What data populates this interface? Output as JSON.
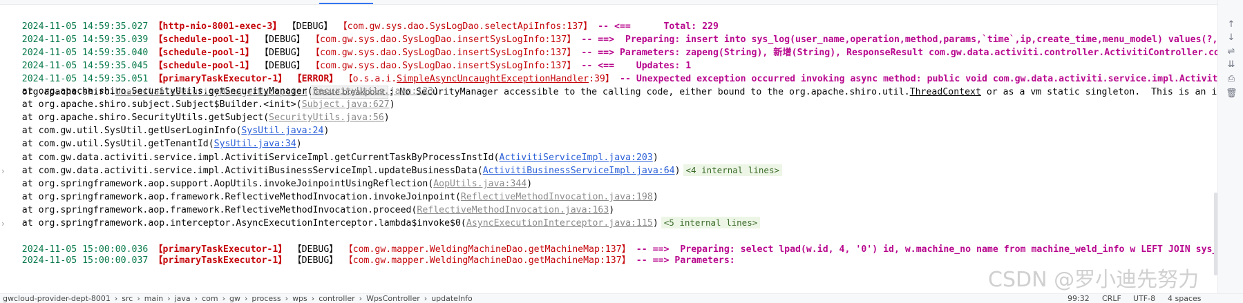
{
  "log": [
    {
      "ts": "2024-11-05 14:59:35.027",
      "thread": "【http-nio-8001-exec-3】",
      "level": "【DEBUG】",
      "logger": "【com.gw.sys.dao.SysLogDao.selectApiInfos:137】",
      "msg": " -- <==      Total: 229"
    },
    {
      "ts": "2024-11-05 14:59:35.039",
      "thread": "【schedule-pool-1】",
      "level": "【DEBUG】",
      "logger": "【com.gw.sys.dao.SysLogDao.insertSysLogInfo:137】",
      "msg": " -- ==>  Preparing: insert into sys_log(user_name,operation,method,params,`time`,ip,create_time,menu_model) values(?,?,?,?,?,?,?,?)"
    },
    {
      "ts": "2024-11-05 14:59:35.040",
      "thread": "【schedule-pool-1】",
      "level": "【DEBUG】",
      "logger": "【com.gw.sys.dao.SysLogDao.insertSysLogInfo:137】",
      "msg": " -- ==> Parameters: zapeng(String), 新增(String), ResponseResult com.gw.data.activiti.controller.ActivitiController.complete"
    },
    {
      "ts": "2024-11-05 14:59:35.045",
      "thread": "【schedule-pool-1】",
      "level": "【DEBUG】",
      "logger": "【com.gw.sys.dao.SysLogDao.insertSysLogInfo:137】",
      "msg": " -- <==    Updates: 1"
    },
    {
      "ts": "2024-11-05 14:59:35.051",
      "thread": "【primaryTaskExecutor-1】",
      "level": "【ERROR】",
      "logger_prefix": "【o.s.a.i.",
      "logger_link": "SimpleAsyncUncaughtExceptionHandler",
      "logger_suffix": ":39】",
      "msg": " -- Unexpected exception occurred invoking async method: public void com.gw.data.activiti.service.impl.ActivitiBusinessServiceImpl"
    }
  ],
  "exception": {
    "prefix": "org.apache.shiro.",
    "cls": "UnavailableSecurityManagerException",
    "tooltip": "Create breakpoint",
    "msg_a": ": No SecurityManager accessible to the calling code, either bound to the org.apache.shiro.util.",
    "msg_link": "ThreadContext",
    "msg_b": " or as a vm static singleton.  This is an invalid application configuration."
  },
  "stack": [
    {
      "at": "    at org.apache.shiro.SecurityUtils.getSecurityManager(",
      "src": "SecurityUtils.java:123",
      "style": "gray",
      "close": ")"
    },
    {
      "at": "    at org.apache.shiro.subject.Subject$Builder.<init>(",
      "src": "Subject.java:627",
      "style": "gray",
      "close": ")"
    },
    {
      "at": "    at org.apache.shiro.SecurityUtils.getSubject(",
      "src": "SecurityUtils.java:56",
      "style": "gray",
      "close": ")"
    },
    {
      "at": "    at com.gw.util.SysUtil.getUserLoginInfo(",
      "src": "SysUtil.java:24",
      "style": "link",
      "close": ")"
    },
    {
      "at": "    at com.gw.util.SysUtil.getTenantId(",
      "src": "SysUtil.java:34",
      "style": "link",
      "close": ")"
    },
    {
      "at": "    at com.gw.data.activiti.service.impl.ActivitiServiceImpl.getCurrentTaskByProcessInstId(",
      "src": "ActivitiServiceImpl.java:203",
      "style": "link",
      "close": ")"
    },
    {
      "at": "    at com.gw.data.activiti.service.impl.ActivitiBusinessServiceImpl.updateBusinessData(",
      "src": "ActivitiBusinessServiceImpl.java:64",
      "style": "link",
      "close": ")",
      "chip": "<4 internal lines>",
      "fold": "›"
    },
    {
      "at": "    at org.springframework.aop.support.AopUtils.invokeJoinpointUsingReflection(",
      "src": "AopUtils.java:344",
      "style": "gray",
      "close": ")"
    },
    {
      "at": "    at org.springframework.aop.framework.ReflectiveMethodInvocation.invokeJoinpoint(",
      "src": "ReflectiveMethodInvocation.java:198",
      "style": "gray",
      "close": ")"
    },
    {
      "at": "    at org.springframework.aop.framework.ReflectiveMethodInvocation.proceed(",
      "src": "ReflectiveMethodInvocation.java:163",
      "style": "gray",
      "close": ")"
    },
    {
      "at": "    at org.springframework.aop.interceptor.AsyncExecutionInterceptor.lambda$invoke$0(",
      "src": "AsyncExecutionInterceptor.java:115",
      "style": "gray",
      "close": ")",
      "chip": "<5 internal lines>",
      "fold": "›"
    }
  ],
  "tail": {
    "ts": "2024-11-05 15:00:00.036",
    "thread": "【primaryTaskExecutor-1】",
    "level": "【DEBUG】",
    "logger": "【com.gw.mapper.WeldingMachineDao.getMachineMap:137】",
    "msg": " -- ==>  Preparing: select lpad(w.id, 4, '0') id, w.machine_no name from machine_weld_info w LEFT JOIN sys_dept d on w.dept_id = d.id",
    "cut_ts": "2024-11-05 15:00:00.037",
    "cut_thread": "【primaryTaskExecutor-1】",
    "cut_level": "【DEBUG】",
    "cut_logger": "【com.gw.mapper.WeldingMachineDao.getMachineMap:137】",
    "cut_msg": " -- ==> Parameters: "
  },
  "status": {
    "path": [
      "gwcloud-provider-dept-8001",
      "src",
      "main",
      "java",
      "com",
      "gw",
      "process",
      "wps",
      "controller",
      "WpsController",
      "updateInfo"
    ],
    "sep": "›",
    "pos": "99:32",
    "eol": "CRLF",
    "enc": "UTF-8",
    "indent": "4 spaces"
  },
  "watermark": "CSDN @罗小迪先努力",
  "tools": [
    "arrow-up-icon",
    "arrow-down-icon",
    "soft-wrap-icon",
    "scroll-to-end-icon",
    "print-icon",
    "trash-icon"
  ],
  "tool_glyphs": [
    "↑",
    "↓",
    "⇌",
    "⇊",
    "⎙",
    "🗑"
  ]
}
